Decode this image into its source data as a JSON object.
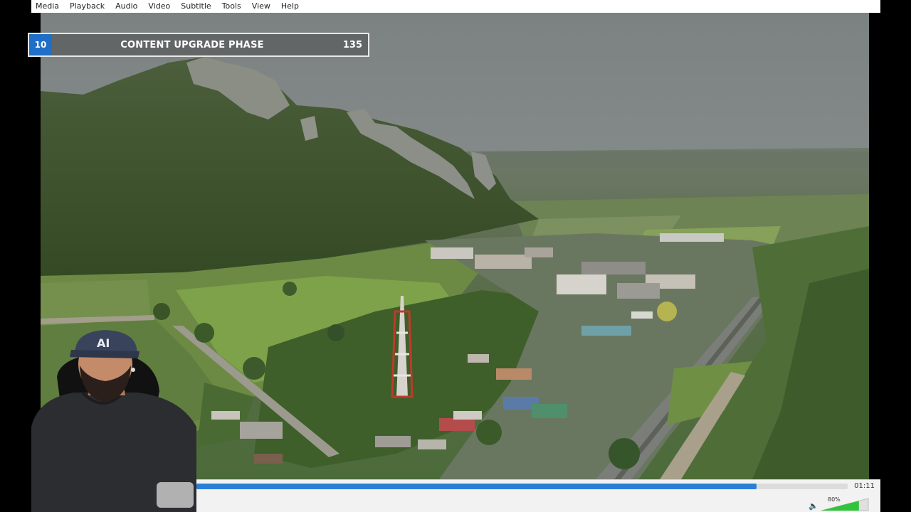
{
  "menu": [
    "Media",
    "Playback",
    "Audio",
    "Video",
    "Subtitle",
    "Tools",
    "View",
    "Help"
  ],
  "overlay": {
    "number": "10",
    "title": "CONTENT UPGRADE PHASE",
    "count": "135"
  },
  "player": {
    "elapsed": "01:11",
    "progress": 0.86,
    "volume": "80%",
    "volume_level": 0.8
  },
  "webcam": {
    "cap_text": "AI"
  },
  "colors": {
    "accent": "#2a7ed8",
    "banner_badge": "#1f6fc9",
    "volume": "#2fc53a"
  }
}
